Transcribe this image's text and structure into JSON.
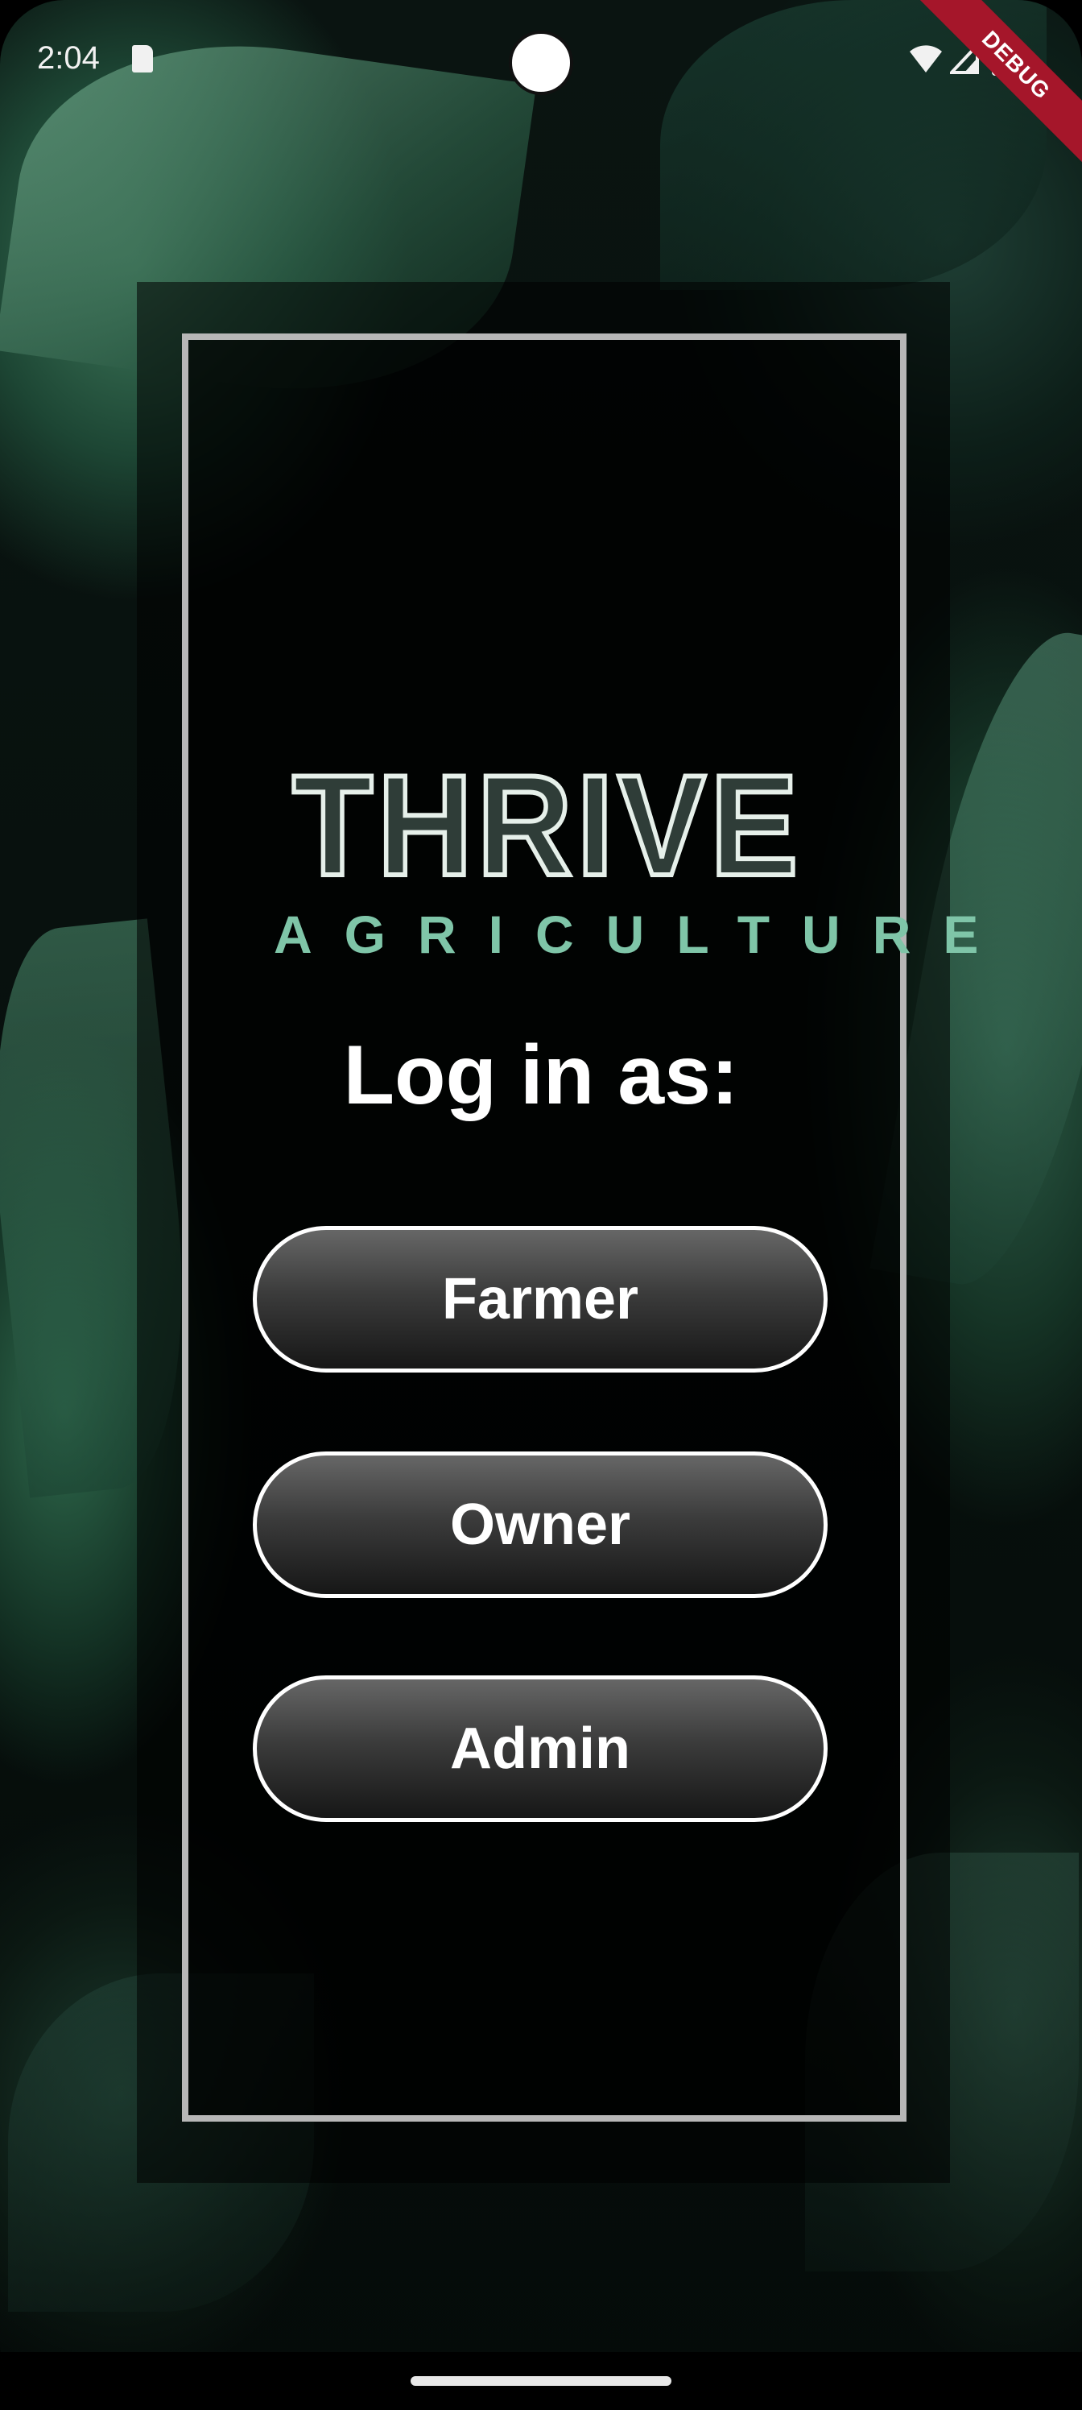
{
  "status_bar": {
    "time": "2:04",
    "icons": [
      "sd-card-icon",
      "wifi-icon",
      "signal-icon",
      "battery-icon"
    ],
    "debug_banner": "DEBUG"
  },
  "logo": {
    "title": "THRIVE",
    "subtitle": "AGRICULTURE"
  },
  "login": {
    "heading": "Log in as:",
    "buttons": [
      {
        "label": "Farmer"
      },
      {
        "label": "Owner"
      },
      {
        "label": "Admin"
      }
    ]
  },
  "colors": {
    "accent": "#7fc5a8",
    "button_border": "#ffffff",
    "panel_border": "#b7b7b7",
    "debug_banner": "#a5162a"
  }
}
